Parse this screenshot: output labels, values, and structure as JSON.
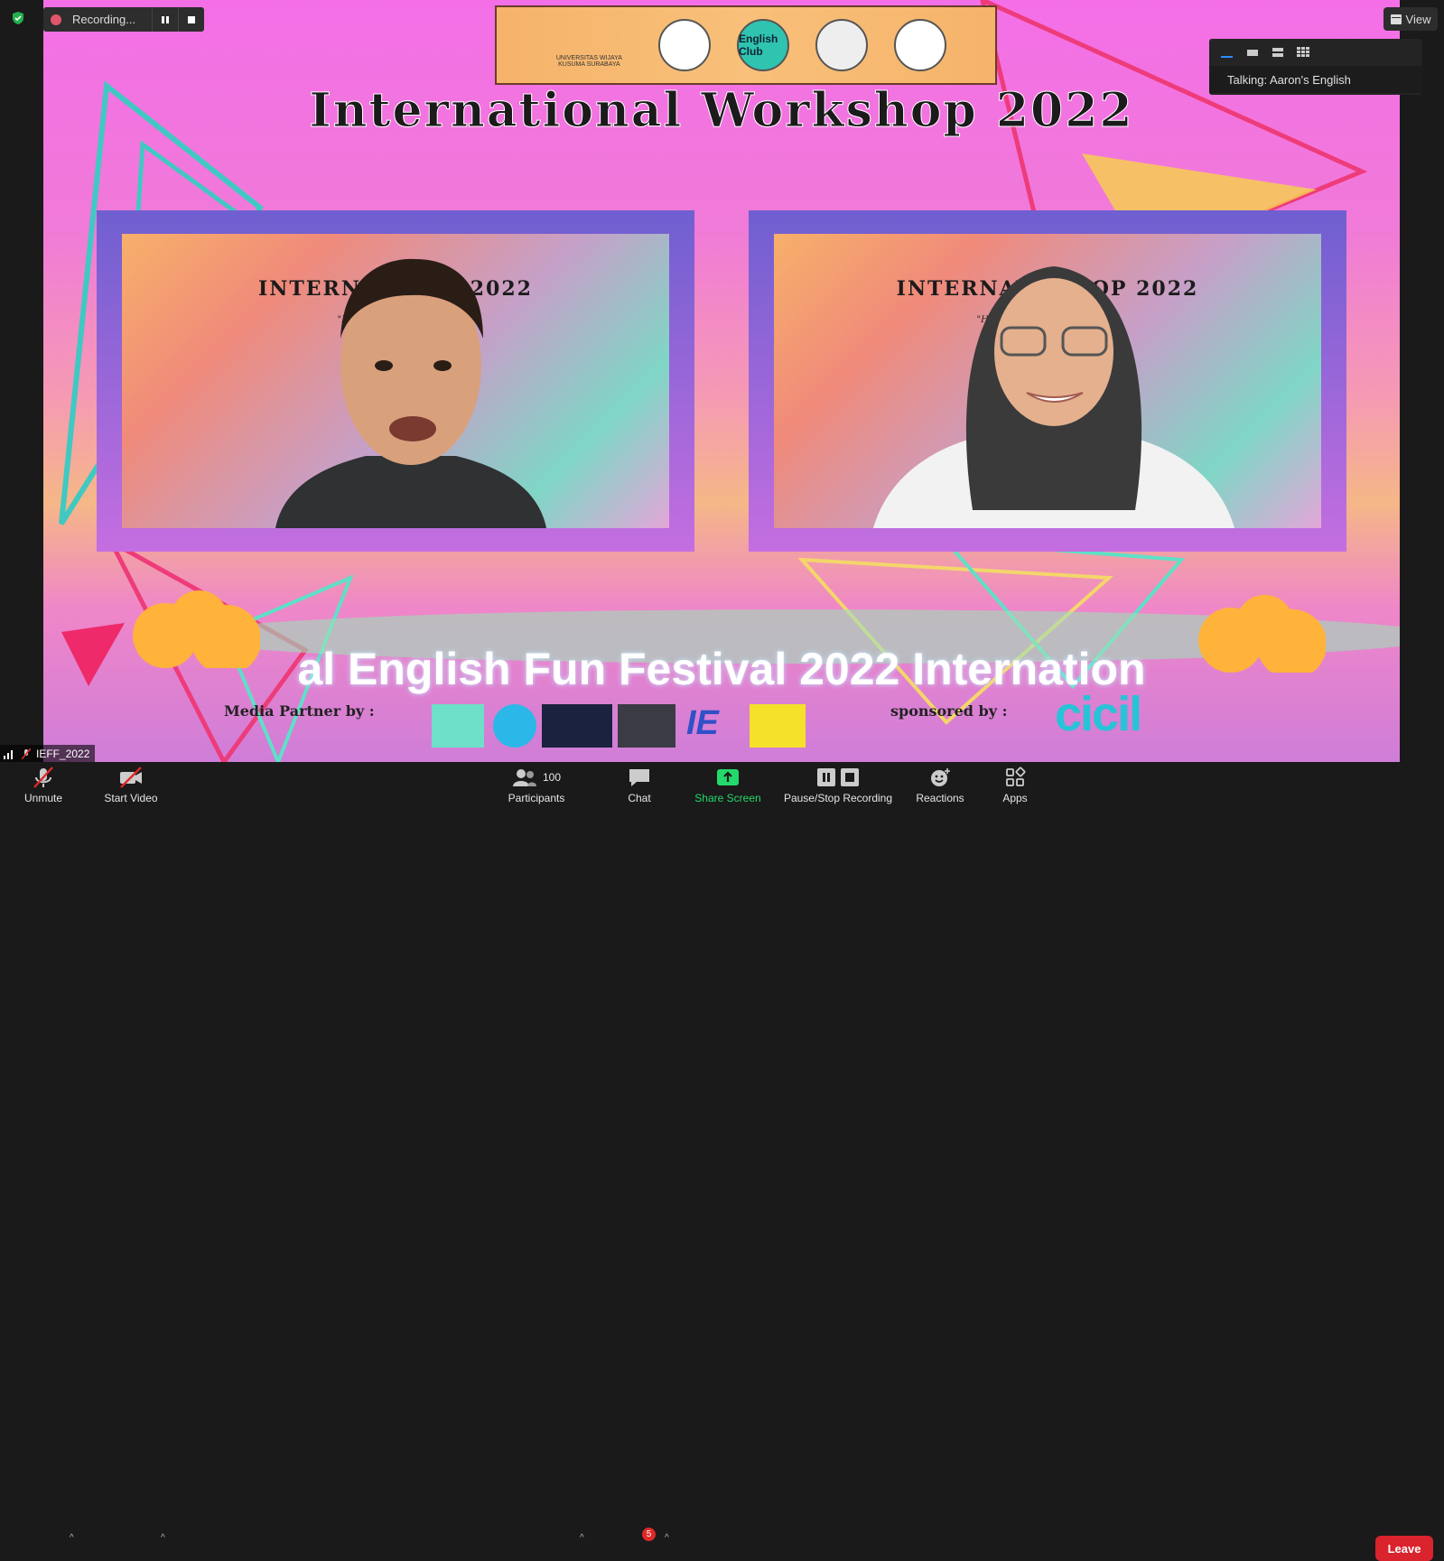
{
  "recording": {
    "label": "Recording..."
  },
  "view": {
    "label": "View"
  },
  "speaker": {
    "talking": "Talking: Aaron's English"
  },
  "share": {
    "title": "International Workshop 2022",
    "banner": {
      "uni_text": "UNIVERSITAS WIJAYA KUSUMA SURABAYA",
      "club_text": "English Club"
    },
    "video_left": {
      "title": "INTERN          KSHOP  2022",
      "sub": "\"How                                      Become a Success\""
    },
    "video_right": {
      "title": "INTERNATIO          HOP  2022",
      "sub": "\"How to Make Ou                             e a Success\""
    },
    "festival": "al English Fun Festival 2022 Internation",
    "media_partner": "Media Partner by :",
    "sponsored_by": "sponsored by :",
    "sponsor_name": "cicil"
  },
  "participant_name": "IEFF_2022",
  "toolbar": {
    "unmute": "Unmute",
    "start_video": "Start Video",
    "participants": "Participants",
    "participants_count": "100",
    "chat": "Chat",
    "chat_badge": "5",
    "share_screen": "Share Screen",
    "pause_stop": "Pause/Stop Recording",
    "reactions": "Reactions",
    "apps": "Apps",
    "leave": "Leave"
  },
  "colors": {
    "accent_green": "#23d96b",
    "leave_red": "#d9232d"
  }
}
